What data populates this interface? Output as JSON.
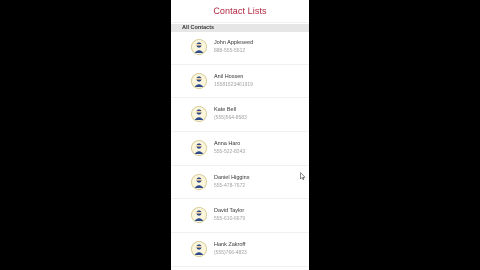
{
  "nav": {
    "title": "Contact Lists"
  },
  "section": {
    "title": "All Contacts"
  },
  "contacts": [
    {
      "name": "John Appleseed",
      "phone": "888-555-5512"
    },
    {
      "name": "Anil Hossen",
      "phone": "15581523461919"
    },
    {
      "name": "Kate Bell",
      "phone": "(555)564-8583"
    },
    {
      "name": "Anna Haro",
      "phone": "555-522-8243"
    },
    {
      "name": "Daniel Higgins",
      "phone": "555-478-7672"
    },
    {
      "name": "David Taylor",
      "phone": "555-610-6679"
    },
    {
      "name": "Hank Zakroff",
      "phone": "(555)766-4823"
    }
  ],
  "icons": {
    "avatar": "person-avatar-icon",
    "cursor": "mouse-pointer-icon"
  },
  "colors": {
    "accent": "#b0253c",
    "avatar_bg": "#fbf6dc"
  }
}
